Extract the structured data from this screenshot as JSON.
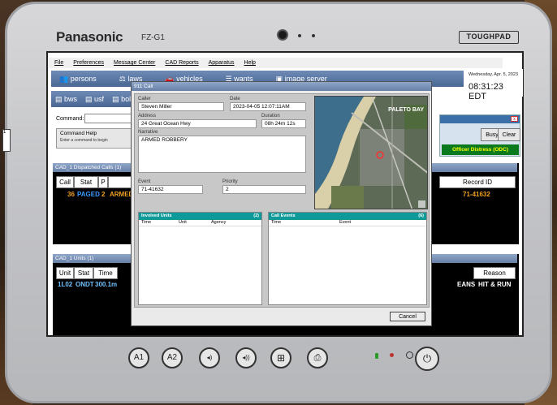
{
  "device": {
    "brand": "Panasonic",
    "model": "FZ-G1",
    "badge": "TOUGHPAD"
  },
  "menubar": [
    "File",
    "Preferences",
    "Message Center",
    "CAD Reports",
    "Apparatus",
    "Help"
  ],
  "datetime": {
    "date": "Wednesday, Apr. 5, 2023",
    "time": "08:31:23 EDT"
  },
  "nav": {
    "row1": [
      "persons",
      "laws",
      "vehicles",
      "wants",
      "image server"
    ],
    "row2": [
      "bws",
      "usf",
      "bol"
    ]
  },
  "command": {
    "label": "Command:",
    "help_title": "Command Help",
    "help_sub": "Enter a command to begin"
  },
  "right_panel": {
    "busy": "Busy",
    "clear": "Clear",
    "distress": "Officer Distress (ODC)",
    "close": "x"
  },
  "side_button": "1",
  "dispatched": {
    "title": "CAD_1 Dispatched Calls (1)",
    "headers": [
      "Call",
      "Stat",
      "P",
      "Record ID"
    ],
    "row": {
      "call": "36",
      "stat": "PAGED",
      "p": "2",
      "type": "ARMED",
      "record": "71-41632"
    }
  },
  "units": {
    "title": "CAD_1 Units (1)",
    "headers": [
      "Unit",
      "Stat",
      "Time",
      "Reason"
    ],
    "row": {
      "unit": "1L02",
      "stat": "ONDT",
      "time": "300.1m",
      "loc": "EANS",
      "reason": "HIT & RUN"
    }
  },
  "modal": {
    "title": "911 Call",
    "caller_label": "Caller",
    "caller": "Steven Miller",
    "date_label": "Date",
    "date": "2023-04-05 12:07:11AM",
    "address_label": "Address",
    "address": "24 Great Ocean Hwy",
    "duration_label": "Duration",
    "duration": "08h 24m 12s",
    "narrative_label": "Narrative",
    "narrative": "ARMED ROBBERY",
    "event_label": "Event",
    "event": "71-41632",
    "priority_label": "Priority",
    "priority": "2",
    "map_label": "PALETO BAY",
    "involved": {
      "title": "Involved Units",
      "count": "(2)",
      "cols": [
        "Time",
        "Unit",
        "Agency"
      ]
    },
    "events": {
      "title": "Call Events",
      "count": "(6)",
      "cols": [
        "Time",
        "Event"
      ]
    },
    "cancel": "Cancel"
  },
  "hw_buttons": [
    "A1",
    "A2",
    "◂)",
    "◂))",
    "⊞",
    "⎙"
  ],
  "colors": {
    "nav": "#5a77a4",
    "paged": "#3a9cff",
    "armed": "#f0a020",
    "distress": "#0b7a1e",
    "teal": "#0f9a9a"
  }
}
